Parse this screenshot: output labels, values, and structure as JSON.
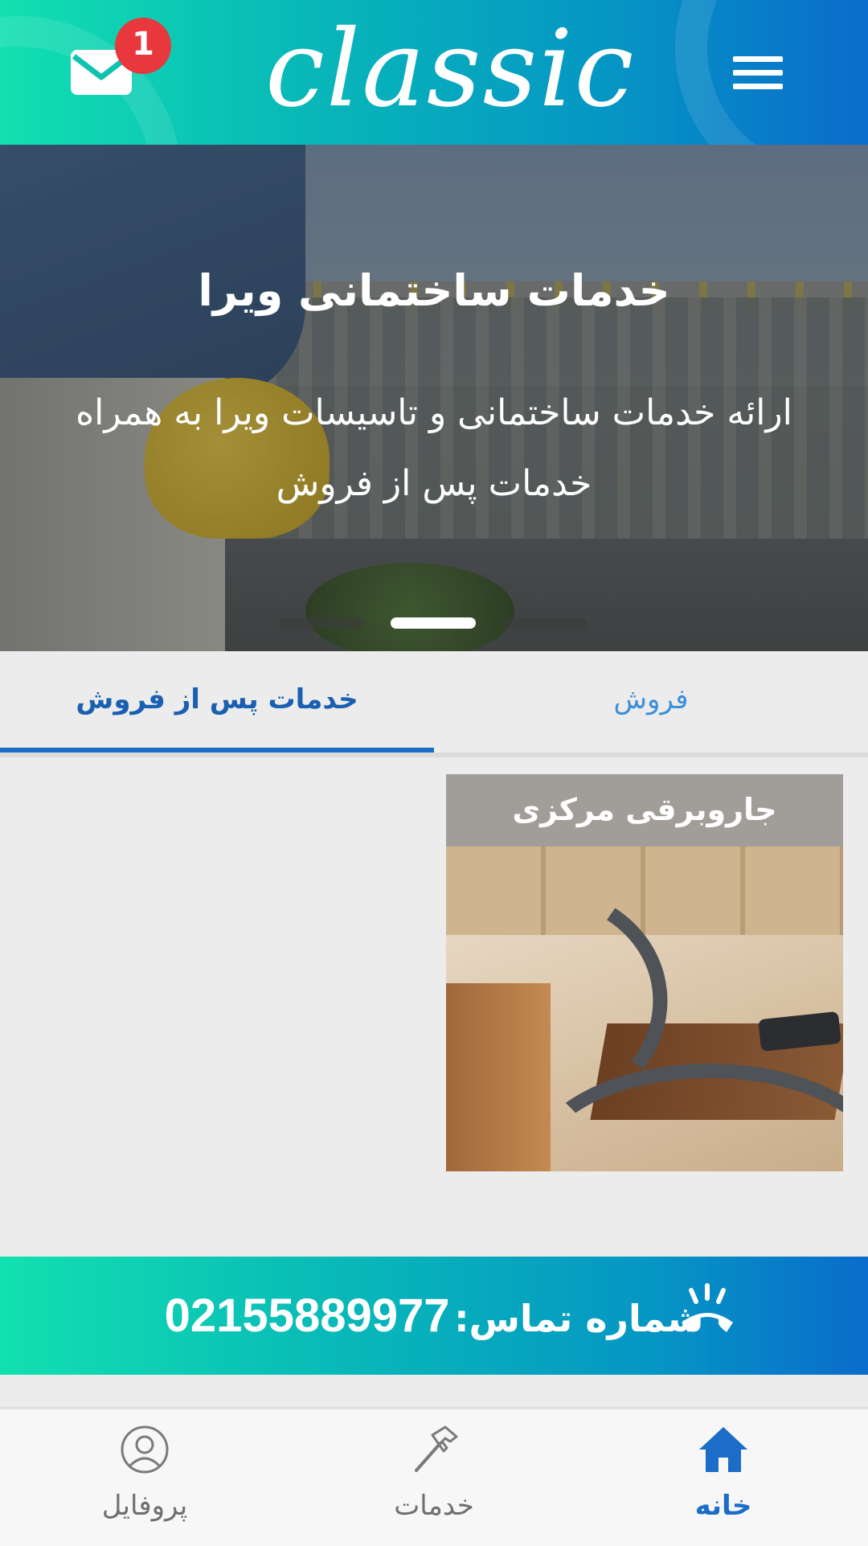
{
  "header": {
    "logo_text": "classic",
    "notification_count": "1",
    "icons": {
      "mail": "mail-icon",
      "menu": "menu-icon"
    },
    "colors": {
      "gradient_start": "#12e0b0",
      "gradient_end": "#0a6ccb"
    }
  },
  "hero": {
    "title": "خدمات ساختمانی ویرا",
    "subtitle_line1": "ارائه خدمات ساختمانی و تاسیسات ویرا به همراه",
    "subtitle_line2": "خدمات پس از فروش",
    "slide_count": 3,
    "active_slide": 2
  },
  "tabs": [
    {
      "label": "فروش",
      "active": false
    },
    {
      "label": "خدمات پس از فروش",
      "active": true
    }
  ],
  "cards": [
    {
      "label": "جاروبرقی مرکزی"
    }
  ],
  "contact": {
    "label": "شماره تماس:",
    "number": "02155889977",
    "icon": "phone-icon"
  },
  "bottom_nav": [
    {
      "label": "خانه",
      "icon": "home-icon",
      "active": true
    },
    {
      "label": "خدمات",
      "icon": "hammer-icon",
      "active": false
    },
    {
      "label": "پروفایل",
      "icon": "profile-icon",
      "active": false
    }
  ],
  "colors": {
    "accent": "#1b6dc7",
    "badge": "#e8373d"
  }
}
